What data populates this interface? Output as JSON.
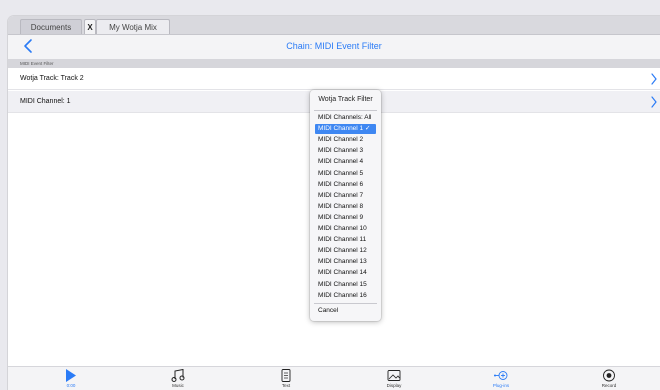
{
  "tabs": {
    "documents": "Documents",
    "close": "X",
    "mix": "My Wotja Mix"
  },
  "nav": {
    "title": "Chain: MIDI Event Filter"
  },
  "section": {
    "header": "MIDI Event Filter"
  },
  "rows": {
    "track": "Wotja Track: Track 2",
    "channel": "MIDI Channel: 1"
  },
  "popup": {
    "title": "Wotja Track Filter",
    "items": [
      "MIDI Channels: All",
      "MIDI Channel 1 ✓",
      "MIDI Channel 2",
      "MIDI Channel 3",
      "MIDI Channel 4",
      "MIDI Channel 5",
      "MIDI Channel 6",
      "MIDI Channel 7",
      "MIDI Channel 8",
      "MIDI Channel 9",
      "MIDI Channel 10",
      "MIDI Channel 11",
      "MIDI Channel 12",
      "MIDI Channel 13",
      "MIDI Channel 14",
      "MIDI Channel 15",
      "MIDI Channel 16"
    ],
    "selected_index": 1,
    "cancel": "Cancel"
  },
  "toolbar": {
    "items": [
      {
        "label": "0:00",
        "icon": "play-icon"
      },
      {
        "label": "Music",
        "icon": "music-note-icon"
      },
      {
        "label": "Text",
        "icon": "document-icon"
      },
      {
        "label": "Display",
        "icon": "image-icon"
      },
      {
        "label": "Plug-ins",
        "icon": "plugin-icon"
      },
      {
        "label": "Record",
        "icon": "record-icon"
      }
    ]
  },
  "colors": {
    "accent": "#2a7bf6",
    "selected": "#3e87f2"
  }
}
